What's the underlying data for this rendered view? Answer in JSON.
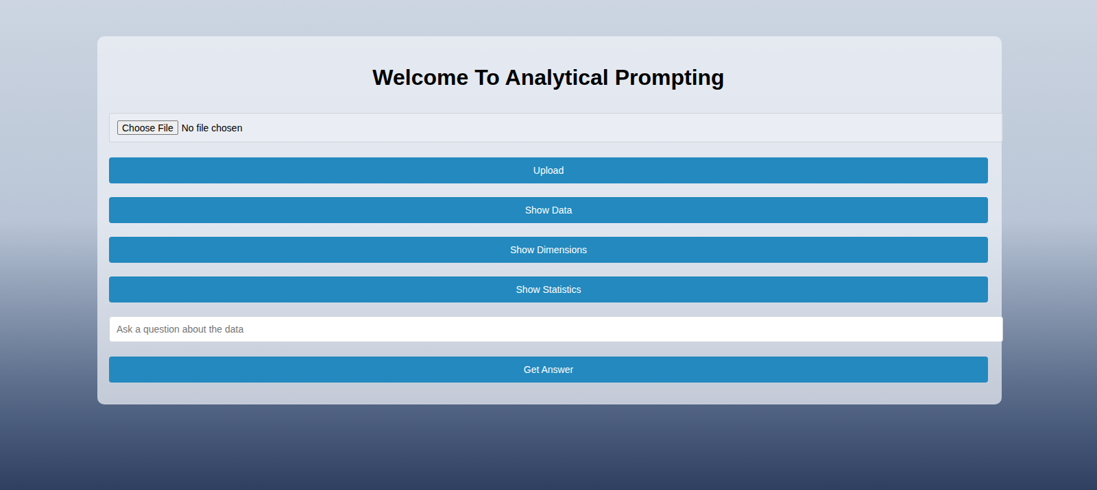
{
  "page": {
    "title": "Welcome To Analytical Prompting"
  },
  "file_input": {
    "button": "Choose File",
    "status": "No file chosen"
  },
  "buttons": [
    "Upload",
    "Show Data",
    "Show Dimensions",
    "Show Statistics"
  ],
  "question": {
    "placeholder": "Ask a question about the data",
    "value": ""
  },
  "submit": "Get Answer"
}
